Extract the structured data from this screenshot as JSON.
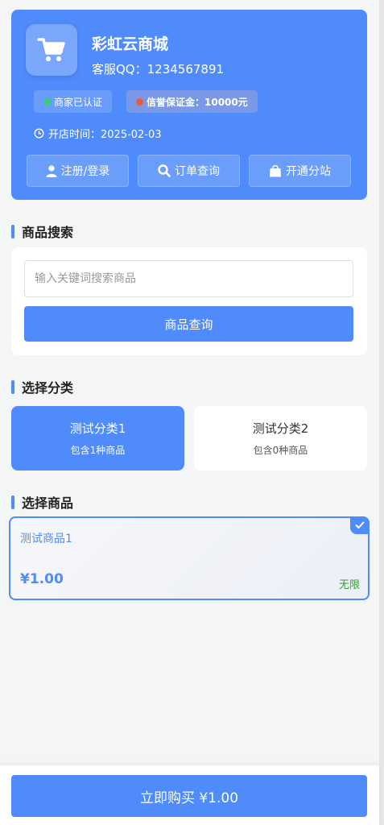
{
  "shop": {
    "name": "彩虹云商城",
    "qq": "客服QQ：1234567891",
    "verified": "商家已认证",
    "deposit": "信誉保证金：10000元",
    "open_time": "开店时间：2025-02-03"
  },
  "actions": [
    {
      "label": "注册/登录",
      "icon": "user-icon"
    },
    {
      "label": "订单查询",
      "icon": "search-icon"
    },
    {
      "label": "开通分站",
      "icon": "bag-icon"
    }
  ],
  "search": {
    "title": "商品搜索",
    "placeholder": "输入关键词搜索商品",
    "button": "商品查询"
  },
  "categories": {
    "title": "选择分类",
    "items": [
      {
        "name": "测试分类1",
        "count": "包含1种商品",
        "selected": true
      },
      {
        "name": "测试分类2",
        "count": "包含0种商品",
        "selected": false
      }
    ]
  },
  "products": {
    "title": "选择商品",
    "items": [
      {
        "name": "测试商品1",
        "price": "¥1.00",
        "stock": "无限",
        "selected": true
      }
    ]
  },
  "buy": {
    "label": "立即购买 ¥1.00"
  },
  "colors": {
    "primary": "#4f8bfa",
    "green": "#3bc97b",
    "red": "#ef5a3c"
  }
}
